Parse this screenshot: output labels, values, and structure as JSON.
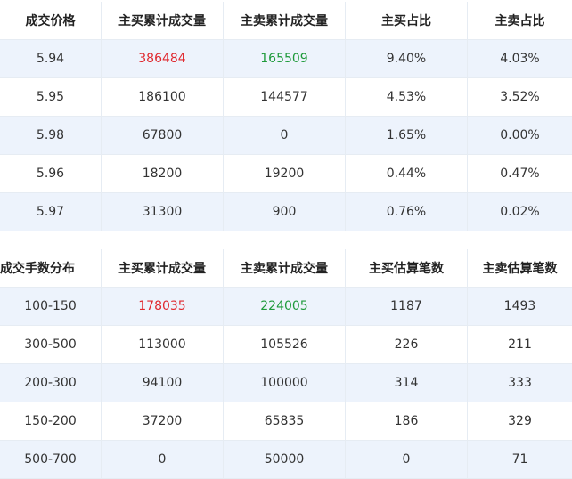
{
  "price_table": {
    "headers": [
      "成交价格",
      "主买累计成交量",
      "主卖累计成交量",
      "主买占比",
      "主卖占比"
    ],
    "rows": [
      [
        "5.94",
        "386484",
        "165509",
        "9.40%",
        "4.03%"
      ],
      [
        "5.95",
        "186100",
        "144577",
        "4.53%",
        "3.52%"
      ],
      [
        "5.98",
        "67800",
        "0",
        "1.65%",
        "0.00%"
      ],
      [
        "5.96",
        "18200",
        "19200",
        "0.44%",
        "0.47%"
      ],
      [
        "5.97",
        "31300",
        "900",
        "0.76%",
        "0.02%"
      ]
    ]
  },
  "lot_table": {
    "headers": [
      "成交手数分布",
      "主买累计成交量",
      "主卖累计成交量",
      "主买估算笔数",
      "主卖估算笔数"
    ],
    "rows": [
      [
        "100-150",
        "178035",
        "224005",
        "1187",
        "1493"
      ],
      [
        "300-500",
        "113000",
        "105526",
        "226",
        "211"
      ],
      [
        "200-300",
        "94100",
        "100000",
        "314",
        "333"
      ],
      [
        "150-200",
        "37200",
        "65835",
        "186",
        "329"
      ],
      [
        "500-700",
        "0",
        "50000",
        "0",
        "71"
      ]
    ]
  },
  "colors": {
    "highlight_buy": "#e0282e",
    "highlight_sell": "#1e9a3a",
    "alt_row_bg": "#edf3fc"
  }
}
